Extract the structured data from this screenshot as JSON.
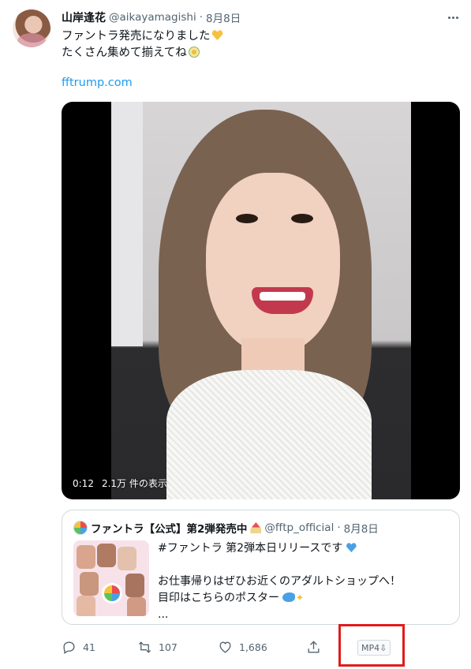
{
  "tweet": {
    "author_name": "山岸逢花",
    "author_handle": "@aikayamagishi",
    "separator": "·",
    "date": "8月8日",
    "text_line1": "ファントラ発売になりました",
    "text_line2": "たくさん集めて揃えてね",
    "link": "fftrump.com",
    "video": {
      "duration": "0:12",
      "views": "2.1万 件の表示"
    }
  },
  "quote": {
    "name": "ファントラ【公式】第2弾発売中",
    "handle": "@fftp_official",
    "separator": "·",
    "date": "8月8日",
    "line1": "#ファントラ 第2弾本日リリースです",
    "line2": "お仕事帰りはぜひお近くのアダルトショップへ！",
    "line3": "目印はこちらのポスター",
    "line4": "..."
  },
  "actions": {
    "replies": "41",
    "retweets": "107",
    "likes": "1,686",
    "mp4_label": "MP4⇩"
  },
  "colors": {
    "link": "#1d9bf0",
    "muted": "#536471",
    "highlight": "#e21b1b"
  }
}
